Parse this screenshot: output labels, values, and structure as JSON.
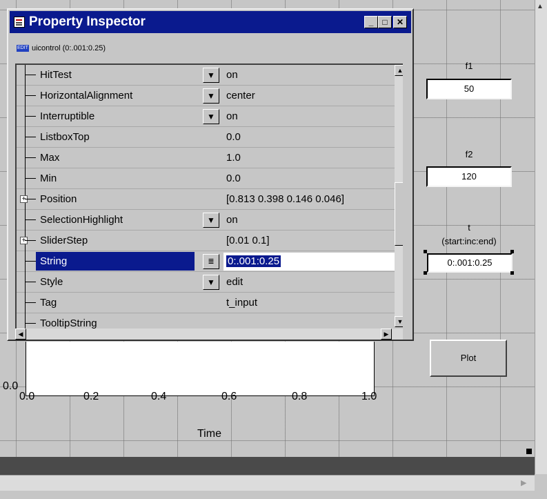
{
  "inspector": {
    "title": "Property Inspector",
    "object_label": "uicontrol (0:.001:0.25)",
    "object_icon": "edit-text-icon",
    "title_buttons": [
      "minimize",
      "maximize",
      "close"
    ],
    "properties": [
      {
        "name": "HitTest",
        "value": "on",
        "dropdown": true,
        "expandable": false
      },
      {
        "name": "HorizontalAlignment",
        "value": "center",
        "dropdown": true,
        "expandable": false
      },
      {
        "name": "Interruptible",
        "value": "on",
        "dropdown": true,
        "expandable": false
      },
      {
        "name": "ListboxTop",
        "value": "0.0",
        "dropdown": false,
        "expandable": false
      },
      {
        "name": "Max",
        "value": "1.0",
        "dropdown": false,
        "expandable": false
      },
      {
        "name": "Min",
        "value": "0.0",
        "dropdown": false,
        "expandable": false
      },
      {
        "name": "Position",
        "value": "[0.813 0.398 0.146 0.046]",
        "dropdown": false,
        "expandable": true
      },
      {
        "name": "SelectionHighlight",
        "value": "on",
        "dropdown": true,
        "expandable": false
      },
      {
        "name": "SliderStep",
        "value": "[0.01 0.1]",
        "dropdown": false,
        "expandable": true
      },
      {
        "name": "String",
        "value": "0:.001:0.25",
        "dropdown": false,
        "expandable": false,
        "selected": true
      },
      {
        "name": "Style",
        "value": "edit",
        "dropdown": true,
        "expandable": false
      },
      {
        "name": "Tag",
        "value": "t_input",
        "dropdown": false,
        "expandable": false
      },
      {
        "name": "TooltipString",
        "value": "",
        "dropdown": false,
        "expandable": false
      }
    ]
  },
  "figure": {
    "f1": {
      "label": "f1",
      "value": "50"
    },
    "f2": {
      "label": "f2",
      "value": "120"
    },
    "t": {
      "label": "t",
      "sublabel": "(start:inc:end)",
      "value": "0:.001:0.25"
    },
    "plot_button": "Plot",
    "axis": {
      "xticks": [
        "0.0",
        "0.2",
        "0.4",
        "0.6",
        "0.8",
        "1.0"
      ],
      "xlabel": "Time",
      "ytick_partial": "0.0"
    }
  },
  "colors": {
    "titlebar": "#0a1a8e",
    "window_bg": "#c6c6c6",
    "selection": "#0a1a8e"
  }
}
